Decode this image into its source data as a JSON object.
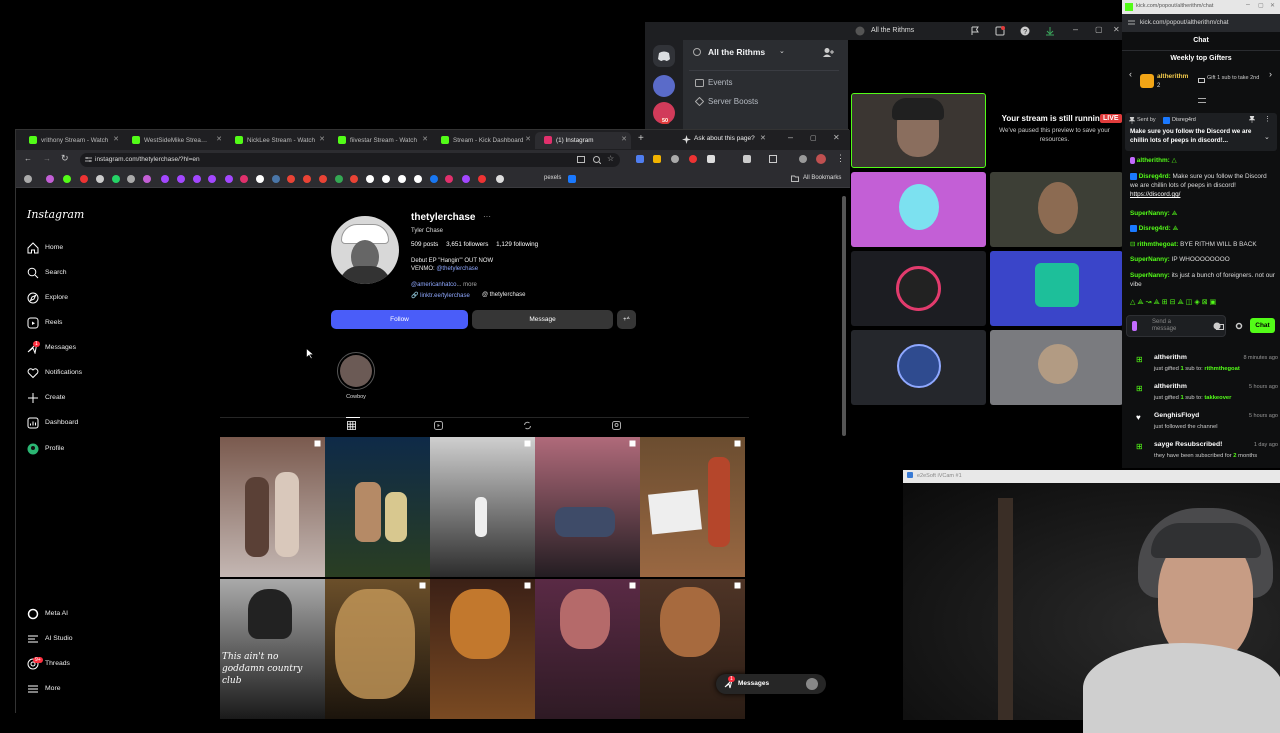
{
  "discord": {
    "title": "All the Rithms",
    "server_name": "All the Rithms",
    "channels": [
      {
        "label": "Events"
      },
      {
        "label": "Server Boosts"
      }
    ],
    "badge": "50",
    "live_label": "LIVE",
    "stream_msg_title": "Your stream is still running!",
    "stream_msg_body": "We've paused this preview to save your resources."
  },
  "browser": {
    "tabs": [
      {
        "label": "vrithony Stream - Watch",
        "color": "#53fc18"
      },
      {
        "label": "WestSideMike Strea…",
        "color": "#53fc18"
      },
      {
        "label": "NickLee Stream - Watch",
        "color": "#53fc18"
      },
      {
        "label": "fiivestar Stream - Watch",
        "color": "#53fc18"
      },
      {
        "label": "Stream - Kick Dashboard",
        "color": "#53fc18"
      },
      {
        "label": "(1) Instagram",
        "color": "#e1306c"
      }
    ],
    "ask_label": "Ask about this page?",
    "url": "instagram.com/thetylerchase/?hl=en",
    "bookmarks_pexels": "pexels",
    "bookmarks_all": "All Bookmarks"
  },
  "instagram": {
    "logo": "Instagram",
    "nav": [
      {
        "label": "Home",
        "icon": "home-icon"
      },
      {
        "label": "Search",
        "icon": "search-icon"
      },
      {
        "label": "Explore",
        "icon": "explore-icon"
      },
      {
        "label": "Reels",
        "icon": "reels-icon"
      },
      {
        "label": "Messages",
        "icon": "messages-icon"
      },
      {
        "label": "Notifications",
        "icon": "heart-icon"
      },
      {
        "label": "Create",
        "icon": "plus-icon"
      },
      {
        "label": "Dashboard",
        "icon": "dashboard-icon"
      },
      {
        "label": "Profile",
        "icon": "profile-icon"
      }
    ],
    "nav_bottom": [
      {
        "label": "Meta AI",
        "icon": "meta-ai-icon"
      },
      {
        "label": "AI Studio",
        "icon": "ai-studio-icon"
      },
      {
        "label": "Threads",
        "icon": "threads-icon"
      },
      {
        "label": "More",
        "icon": "menu-icon"
      }
    ],
    "messages_badge": "1",
    "threads_badge": "9+",
    "profile": {
      "username": "thetylerchase",
      "full_name": "Tyler Chase",
      "posts": "509 posts",
      "followers": "3,651 followers",
      "following": "1,129 following",
      "bio1": "Debut EP \"Hangin'\" OUT NOW",
      "bio2_prefix": "VENMO:",
      "bio2_handle": "@thetylerchase",
      "mention": "@americanhatco",
      "more": "... more",
      "link": "linktr.ee/tylerchase",
      "threads_handle": "thetylerchase"
    },
    "follow_label": "Follow",
    "message_label": "Message",
    "highlight_label": "Cowboy",
    "post_text": "This ain't no goddamn country club",
    "messages_bar": "Messages",
    "messages_bar_badge": "1"
  },
  "kick": {
    "url": "kick.com/popout/altherithm/chat",
    "title_bar": "kick.com/popout/altherithm/chat",
    "header": "Chat",
    "gifters_title": "Weekly top Gifters",
    "gifter_name": "altherithm",
    "gifter_count": "2",
    "gifter_note": "Gift 1 sub to take 2nd",
    "pinned_by_label": "Sent by",
    "pinned_by": "Disreg4rd",
    "pinned_text": "Make sure you follow the Discord we are chillin lots of peeps in discord!...",
    "messages": [
      {
        "user": "altherithm:",
        "text": "",
        "color": "#53fc18"
      },
      {
        "user": "Disreg4rd:",
        "text": "Make sure you follow the Discord we are chillin lots of peeps in discord!",
        "link": "https://discord.gg/",
        "color": "#53fc18"
      },
      {
        "user": "SuperNanny:",
        "text": "",
        "color": "#53fc18"
      },
      {
        "user": "Disreg4rd:",
        "text": "",
        "color": "#53fc18"
      },
      {
        "user": "rithmthegoat:",
        "text": "BYE RITHM WILL B BACK",
        "color": "#53fc18"
      },
      {
        "user": "SuperNanny:",
        "text": "IP WHOOOOOOOO",
        "color": "#53fc18"
      },
      {
        "user": "SuperNanny:",
        "text": "its just a bunch of foreigners. not our vibe",
        "color": "#53fc18"
      }
    ],
    "input_placeholder": "Send a message",
    "chat_button": "Chat",
    "activity": [
      {
        "name": "altherithm",
        "time": "8 minutes ago",
        "action": "just gifted",
        "count": "1",
        "mid": "sub to:",
        "target": "rithmthegoat"
      },
      {
        "name": "altherithm",
        "time": "5 hours ago",
        "action": "just gifted",
        "count": "1",
        "mid": "sub to:",
        "target": "takkeover"
      },
      {
        "name": "GenghisFloyd",
        "time": "5 hours ago",
        "action": "just followed the channel",
        "count": "",
        "mid": "",
        "target": ""
      },
      {
        "name": "sayge Resubscribed!",
        "time": "1 day ago",
        "action": "they have been subscribed for",
        "count": "2",
        "mid": "months",
        "target": ""
      }
    ]
  },
  "webcam": {
    "title": "e2eSoft iVCam #1"
  },
  "colors": {
    "kick_green": "#53fc18",
    "ig_blue": "#4a5df9",
    "discord_blurple": "#5865f2"
  }
}
